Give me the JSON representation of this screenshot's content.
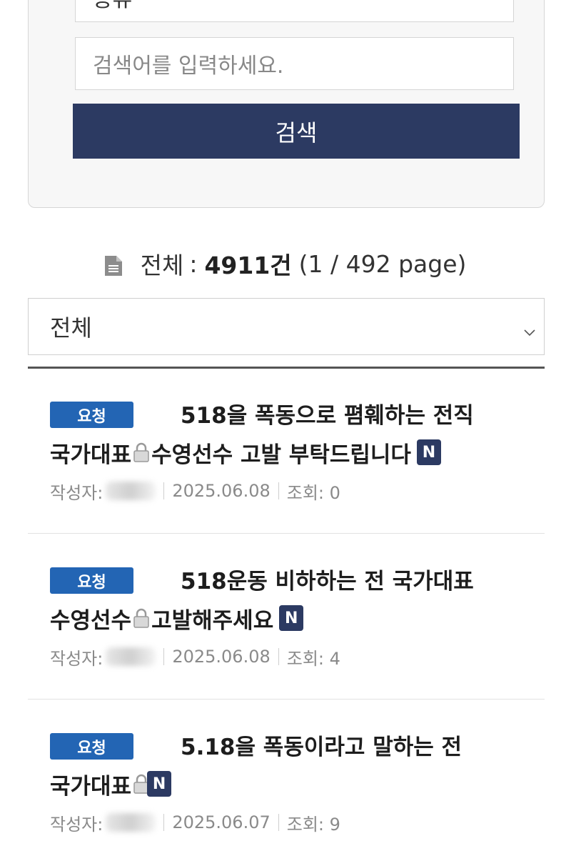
{
  "search": {
    "category_value": "종류",
    "keyword_placeholder": "검색어를 입력하세요.",
    "button_label": "검색"
  },
  "summary": {
    "total_label": "전체",
    "colon": ":",
    "count": "4911건",
    "page_info": "(1 / 492 page)"
  },
  "filter": {
    "selected": "전체"
  },
  "posts": [
    {
      "badge": "요청",
      "title_line1": "518을 폭동으로 폄훼하는 전직",
      "title_line2_a": "국가대표",
      "title_line2_b": "수영선수 고발 부탁드립니다",
      "new": "N",
      "author_label": "작성자:",
      "date": "2025.06.08",
      "views": "조회: 0"
    },
    {
      "badge": "요청",
      "title_line1": "518운동 비하하는 전 국가대표",
      "title_line2_a": "수영선수",
      "title_line2_b": "고발해주세요",
      "new": "N",
      "author_label": "작성자:",
      "date": "2025.06.08",
      "views": "조회: 4"
    },
    {
      "badge": "요청",
      "title_line1": "5.18을 폭동이라고 말하는 전",
      "title_line2_a": "국가대표",
      "title_line2_b": "",
      "new": "N",
      "author_label": "작성자:",
      "date": "2025.06.07",
      "views": "조회: 9"
    }
  ],
  "icons": {
    "document": "document-icon",
    "chevron": "chevron-down-icon",
    "lock": "lock-icon"
  },
  "colors": {
    "primary_button": "#2c3a62",
    "badge_blue": "#2365b4",
    "new_badge": "#2c3a62"
  }
}
